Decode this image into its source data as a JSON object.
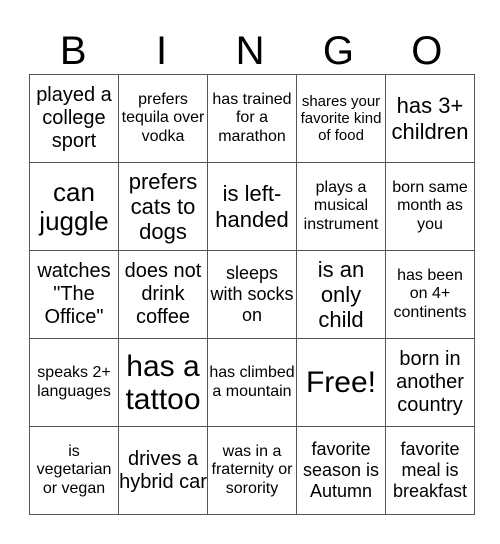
{
  "header": [
    "B",
    "I",
    "N",
    "G",
    "O"
  ],
  "rows": [
    [
      "played a college sport",
      "prefers tequila over vodka",
      "has trained for a marathon",
      "shares your favorite kind of food",
      "has 3+ children"
    ],
    [
      "can juggle",
      "prefers cats to dogs",
      "is left-handed",
      "plays a musical instrument",
      "born same month as you"
    ],
    [
      "watches \"The Office\"",
      "does not drink coffee",
      "sleeps with socks on",
      "is an only child",
      "has been on 4+ continents"
    ],
    [
      "speaks 2+ languages",
      "has a tattoo",
      "has climbed a mountain",
      "Free!",
      "born in another country"
    ],
    [
      "is vegetarian or vegan",
      "drives a hybrid car",
      "was in a fraternity or sorority",
      "favorite season is Autumn",
      "favorite meal is breakfast"
    ]
  ]
}
